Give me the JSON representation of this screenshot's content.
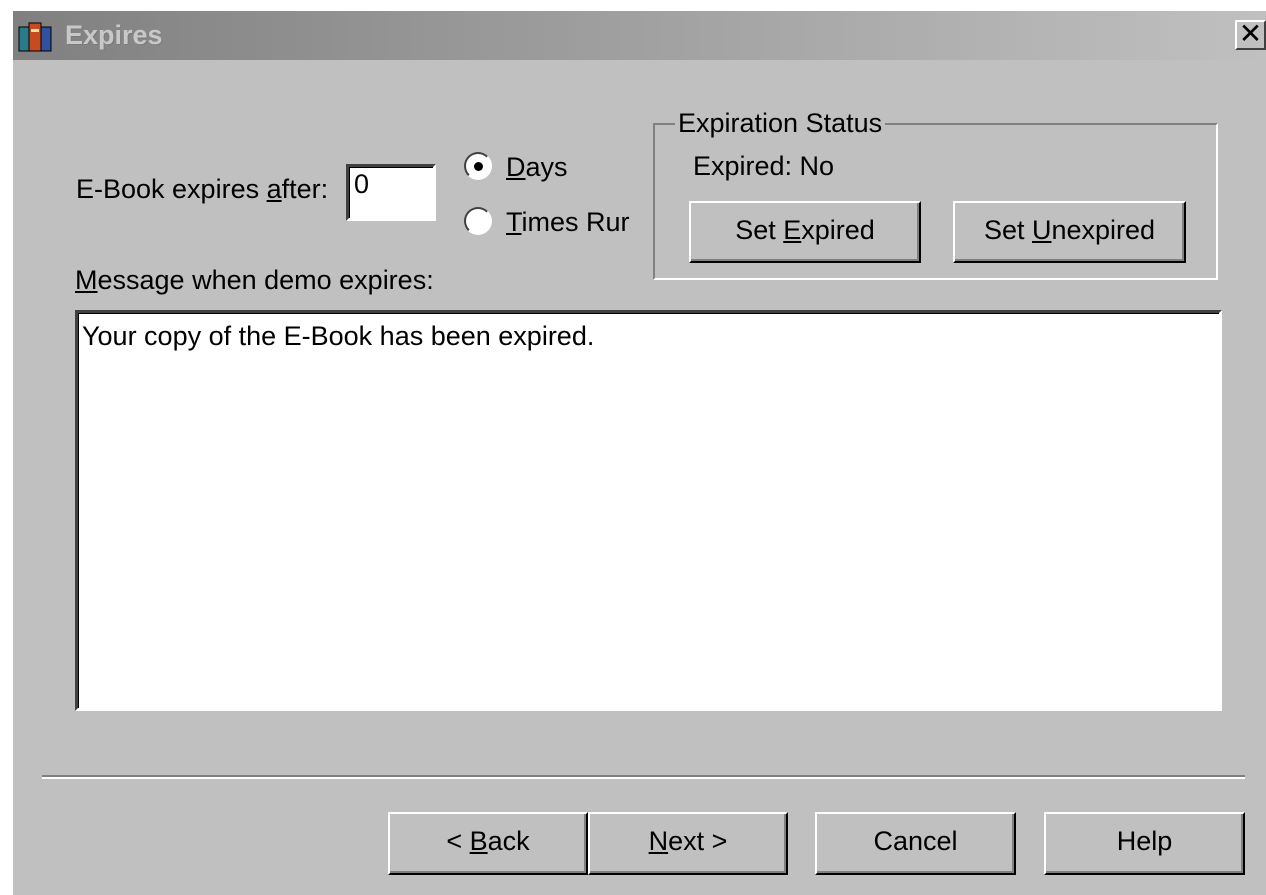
{
  "window": {
    "title": "Expires",
    "icon": "ebook-app-icon",
    "close_label": "✕"
  },
  "expiry": {
    "label_prefix": "E-Book expires ",
    "label_mnemonic": "a",
    "label_suffix": "fter:",
    "value": "0"
  },
  "unit_options": [
    {
      "mnemonic": "D",
      "rest": "ays",
      "selected": true
    },
    {
      "mnemonic": "T",
      "rest": "imes Rur",
      "selected": false
    }
  ],
  "status_group": {
    "title": "Expiration Status",
    "status_text": "Expired: No",
    "set_expired": {
      "prefix": "Set ",
      "mnemonic": "E",
      "rest": "xpired"
    },
    "set_unexpired": {
      "prefix": "Set ",
      "mnemonic": "U",
      "rest": "nexpired"
    }
  },
  "message": {
    "label_mnemonic": "M",
    "label_rest": "essage when demo expires:",
    "text": "Your copy of the E-Book has been expired."
  },
  "footer": {
    "back": {
      "prefix": "< ",
      "mnemonic": "B",
      "rest": "ack"
    },
    "next": {
      "mnemonic": "N",
      "rest": "ext >"
    },
    "cancel": "Cancel",
    "help": "Help"
  }
}
